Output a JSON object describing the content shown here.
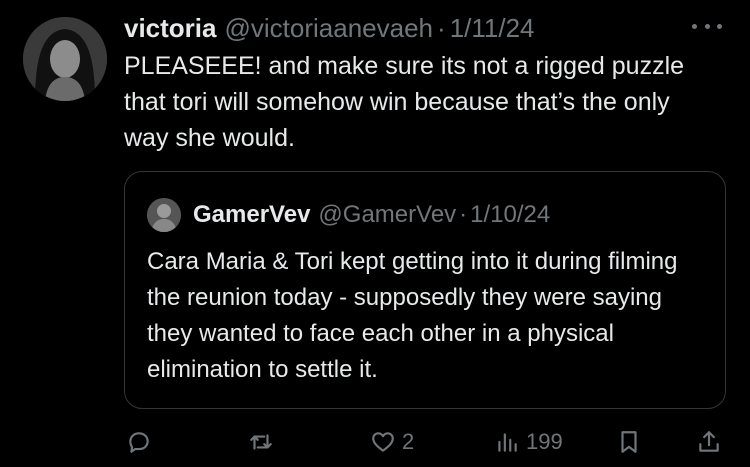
{
  "tweet": {
    "author_name": "victoria",
    "author_handle": "@victoriaanevaeh",
    "separator": "·",
    "date": "1/11/24",
    "text": "PLEASEEE! and make sure its not a rigged puzzle that tori will somehow win because that’s the only way she would.",
    "avatar_icon": "user-avatar"
  },
  "quoted": {
    "author_name": "GamerVev",
    "author_handle": "@GamerVev",
    "separator": "·",
    "date": "1/10/24",
    "text": "Cara Maria & Tori kept getting into it during filming the reunion today - supposedly they were saying they wanted to face each other in a physical elimination to settle it.",
    "avatar_icon": "user-avatar"
  },
  "actions": {
    "reply_icon": "reply-icon",
    "retweet_icon": "retweet-icon",
    "like_icon": "heart-icon",
    "like_count": "2",
    "views_icon": "views-icon",
    "views_count": "199",
    "bookmark_icon": "bookmark-icon",
    "share_icon": "share-icon"
  },
  "colors": {
    "background": "#000000",
    "text_primary": "#e7e9ea",
    "text_secondary": "#71767b",
    "border": "#333639"
  }
}
